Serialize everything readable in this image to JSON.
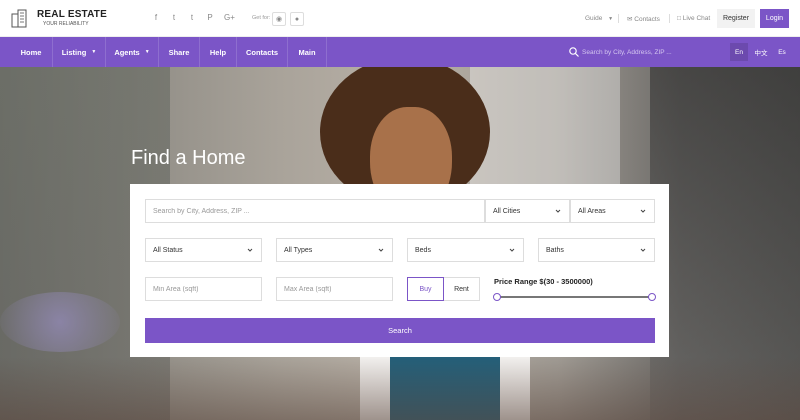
{
  "header": {
    "logo_title": "REAL ESTATE",
    "logo_subtitle": "YOUR RELIABILITY",
    "social_icons": [
      "facebook-icon",
      "twitter-icon",
      "tumblr-icon",
      "pinterest-icon",
      "google-plus-icon"
    ],
    "social_glyphs": [
      "f",
      "t",
      "t",
      "P",
      "G+"
    ],
    "get_for_label": "Get for:",
    "guide_label": "Guide",
    "contacts_label": "Contacts",
    "live_chat_label": "Live Chat",
    "register_label": "Register",
    "login_label": "Login"
  },
  "nav": {
    "items": [
      {
        "label": "Home",
        "dropdown": false
      },
      {
        "label": "Listing",
        "dropdown": true
      },
      {
        "label": "Agents",
        "dropdown": true
      },
      {
        "label": "Share",
        "dropdown": false
      },
      {
        "label": "Help",
        "dropdown": false
      },
      {
        "label": "Contacts",
        "dropdown": false
      },
      {
        "label": "Main",
        "dropdown": false
      }
    ],
    "search_placeholder": "Search by City, Address, ZIP ...",
    "languages": [
      {
        "label": "En",
        "active": true
      },
      {
        "label": "中文",
        "active": false
      },
      {
        "label": "Es",
        "active": false
      }
    ]
  },
  "hero": {
    "title": "Find a Home"
  },
  "search_form": {
    "query_placeholder": "Search by City, Address, ZIP ...",
    "city_select": "All Cities",
    "area_select": "All Areas",
    "status_select": "All Status",
    "type_select": "All Types",
    "beds_select": "Beds",
    "baths_select": "Baths",
    "min_area_placeholder": "Min Area (sqft)",
    "max_area_placeholder": "Max Area (sqft)",
    "buy_label": "Buy",
    "rent_label": "Rent",
    "selected_mode": "Buy",
    "price_range_label": "Price Range $(30 - 3500000)",
    "price_min": 30,
    "price_max": 3500000,
    "submit_label": "Search"
  },
  "colors": {
    "brand": "#7b55c7"
  }
}
